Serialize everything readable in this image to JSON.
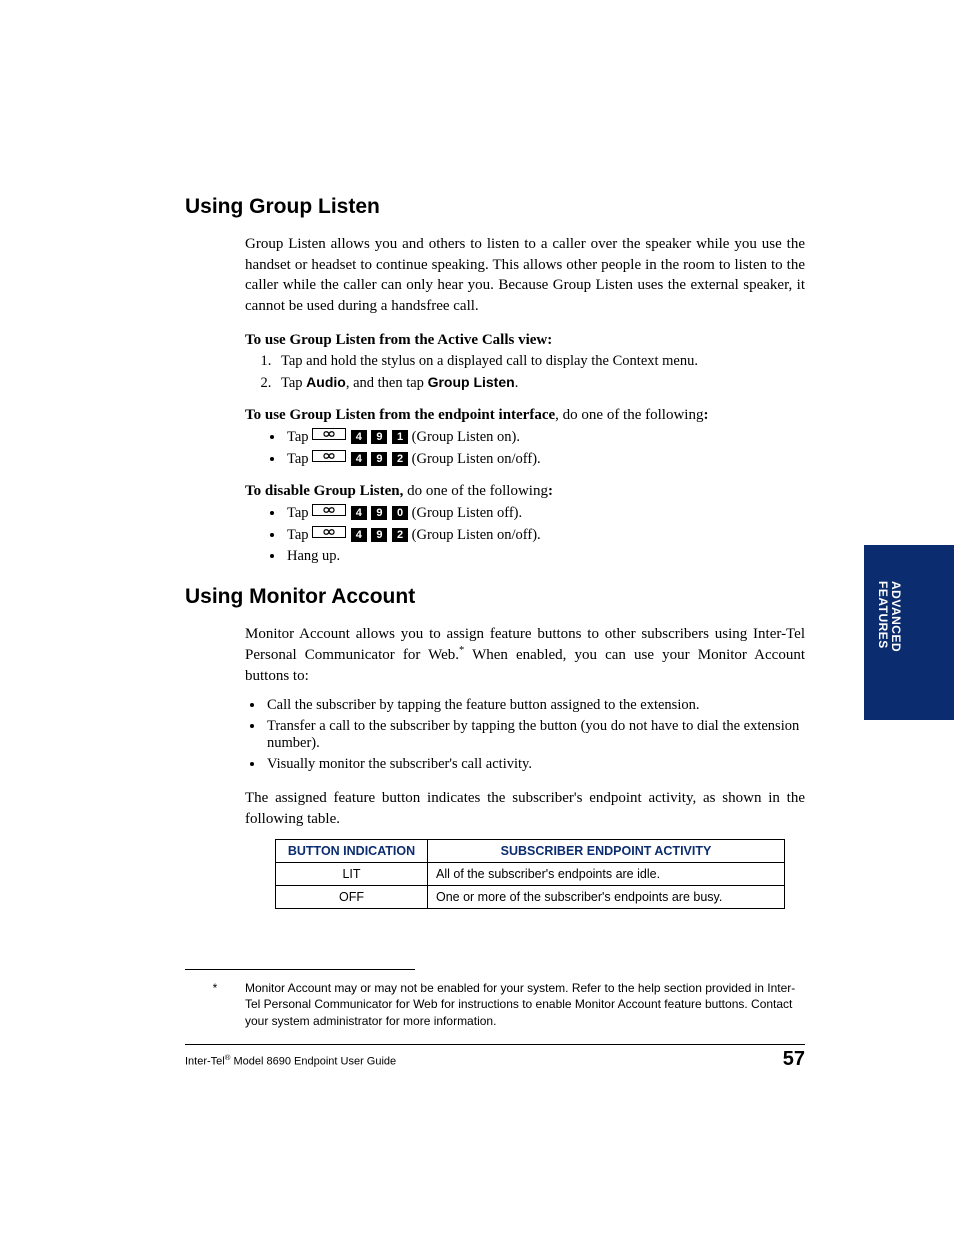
{
  "section1": {
    "heading": "Using Group Listen",
    "intro": "Group Listen allows you and others to listen to a caller over the speaker while you use the handset or headset to continue speaking. This allows other people in the room to listen to the caller while the caller can only hear you. Because Group Listen uses the external speaker, it cannot be used during a handsfree call.",
    "sub1_title": "To use Group Listen from the Active Calls view:",
    "sub1_step1": "Tap and hold the stylus on a displayed call to display the Context menu.",
    "sub1_step2_pre": "Tap ",
    "sub1_step2_b1": "Audio",
    "sub1_step2_mid": ", and then tap ",
    "sub1_step2_b2": "Group Listen",
    "sub1_step2_post": ".",
    "sub2_title_b": "To use Group Listen from the endpoint interface",
    "sub2_title_rest": ", do one of the following",
    "sub2_colon": ":",
    "tap_pre": "Tap ",
    "k4": "4",
    "k9": "9",
    "k1": "1",
    "k2": "2",
    "k0": "0",
    "gl_on": " (Group Listen on).",
    "gl_onoff": " (Group Listen on/off).",
    "gl_off": " (Group Listen off).",
    "sub3_title_b": "To disable Group Listen, ",
    "sub3_title_rest": "do one of the following",
    "sub3_colon": ":",
    "hangup": "Hang up."
  },
  "section2": {
    "heading": "Using Monitor Account",
    "intro_1": "Monitor Account allows you to assign feature buttons to other subscribers using Inter-Tel Personal Communicator for Web.",
    "intro_2": " When enabled, you can use your Monitor Account buttons to:",
    "b1": "Call the subscriber by tapping the feature button assigned to the extension.",
    "b2": "Transfer a call to the subscriber by tapping the button (you do not have to dial the extension number).",
    "b3": "Visually monitor the subscriber's call activity.",
    "post": "The assigned feature button indicates the subscriber's endpoint activity, as shown in the following table.",
    "table": {
      "h1": "BUTTON INDICATION",
      "h2": "SUBSCRIBER ENDPOINT ACTIVITY",
      "r1c1": "LIT",
      "r1c2": "All of the subscriber's endpoints are idle.",
      "r2c1": "OFF",
      "r2c2": "One or more of the subscriber's endpoints are busy."
    }
  },
  "footnote": {
    "mark": "*",
    "text": "Monitor Account may or may not be enabled for your system. Refer to the help section provided in Inter-Tel Personal Communicator for Web for instructions to enable Monitor Account feature buttons. Contact your system administrator for more information."
  },
  "footer": {
    "left_pre": "Inter-Tel",
    "left_reg": "®",
    "left_post": " Model 8690 Endpoint User Guide",
    "page": "57"
  },
  "sidetab": {
    "line1": "ADVANCED",
    "line2": "FEATURES"
  }
}
